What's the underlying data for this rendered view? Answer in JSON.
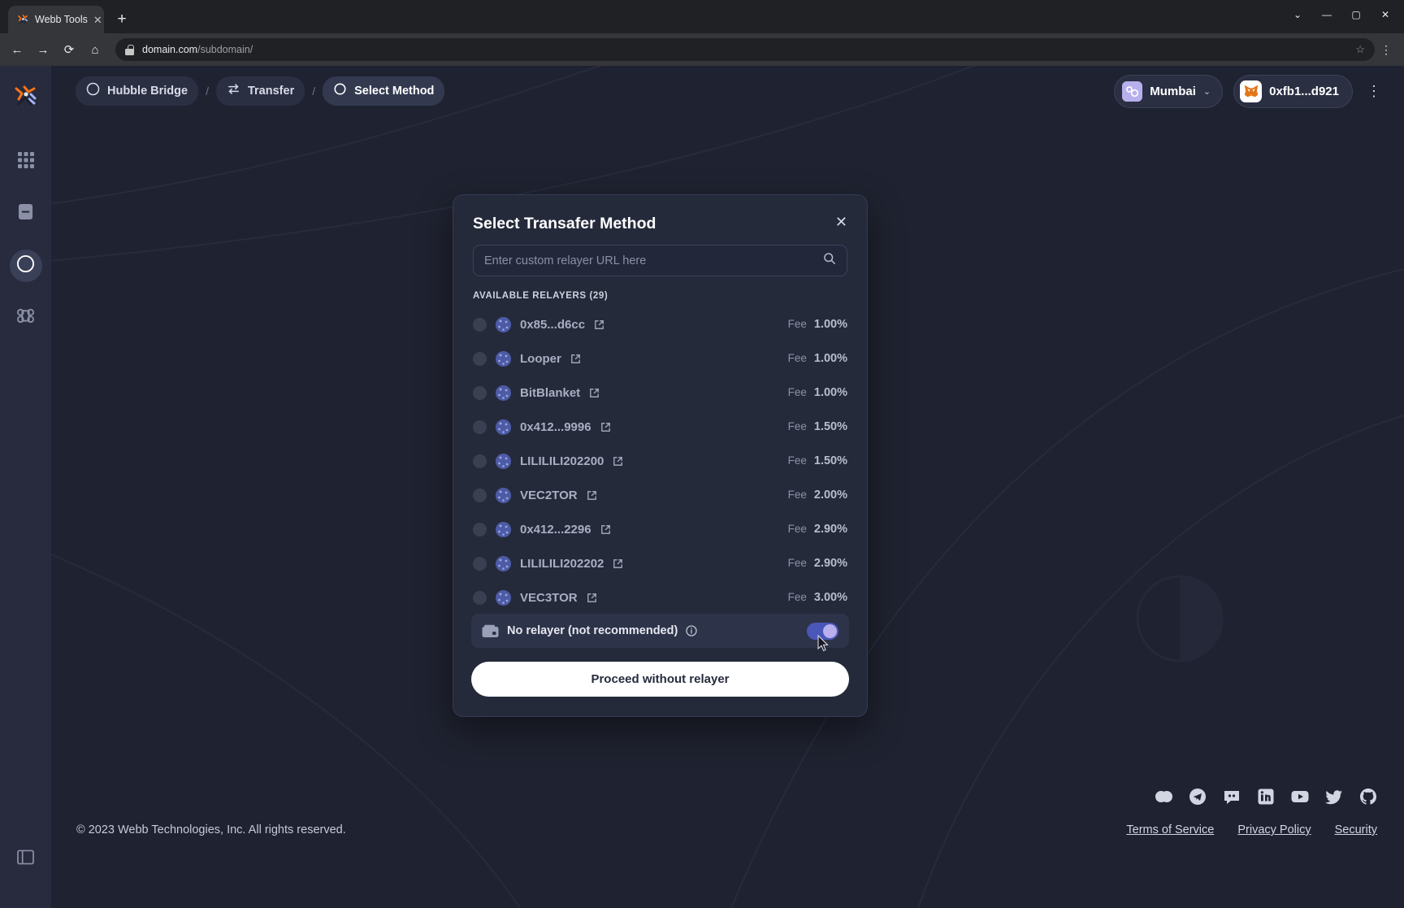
{
  "browser": {
    "tab_title": "Webb Tools",
    "tab_close": "✕",
    "newtab_label": "+",
    "window_minimize": "—",
    "window_maximize": "▢",
    "window_close": "✕",
    "window_chevron": "⌄",
    "back_icon": "←",
    "forward_icon": "→",
    "reload_icon": "⟳",
    "home_icon": "⌂",
    "url_domain": "domain.com",
    "url_path": "/subdomain/",
    "star_icon": "☆",
    "menu_icon": "⋮"
  },
  "sidebar": {
    "items": [
      {
        "name": "webb-logo",
        "label": ""
      },
      {
        "name": "apps-grid",
        "label": ""
      },
      {
        "name": "statistics",
        "label": ""
      },
      {
        "name": "bridge",
        "label": "",
        "active": true
      },
      {
        "name": "faucet",
        "label": ""
      },
      {
        "name": "docs",
        "label": ""
      }
    ]
  },
  "topbar": {
    "breadcrumbs": [
      {
        "label": "Hubble Bridge",
        "icon": "bridge-icon",
        "state": "chip"
      },
      {
        "label": "Transfer",
        "icon": "transfer-icon",
        "state": "chip"
      },
      {
        "label": "Select Method",
        "icon": "circle-icon",
        "state": "current"
      }
    ],
    "separator": "/",
    "chain": {
      "name": "Mumbai",
      "chevron": "⌄"
    },
    "account": {
      "address": "0xfb1...d921"
    },
    "overflow_menu": "⋮"
  },
  "modal": {
    "title": "Select Transafer Method",
    "close_label": "✕",
    "search_placeholder": "Enter custom relayer URL here",
    "search_value": "",
    "search_icon": "search-icon",
    "section_label": "AVAILABLE RELAYERS (29)",
    "fee_label": "Fee",
    "relayers": [
      {
        "name": "0x85...d6cc",
        "fee": "1.00%",
        "selected": false
      },
      {
        "name": "Looper",
        "fee": "1.00%",
        "selected": false
      },
      {
        "name": "BitBlanket",
        "fee": "1.00%",
        "selected": false
      },
      {
        "name": "0x412...9996",
        "fee": "1.50%",
        "selected": false
      },
      {
        "name": "LILILILI202200",
        "fee": "1.50%",
        "selected": false
      },
      {
        "name": "VEC2TOR",
        "fee": "2.00%",
        "selected": false
      },
      {
        "name": "0x412...2296",
        "fee": "2.90%",
        "selected": false
      },
      {
        "name": "LILILILI202202",
        "fee": "2.90%",
        "selected": false
      },
      {
        "name": "VEC3TOR",
        "fee": "3.00%",
        "selected": false
      }
    ],
    "no_relayer": {
      "label": "No relayer (not recommended)",
      "info_icon": "info-icon",
      "wallet_icon": "wallet-icon",
      "toggle_on": true
    },
    "proceed_label": "Proceed without relayer"
  },
  "footer": {
    "copyright": "© 2023 Webb Technologies, Inc. All rights reserved.",
    "socials": [
      "commons-icon",
      "telegram-icon",
      "discord-icon",
      "linkedin-icon",
      "youtube-icon",
      "twitter-icon",
      "github-icon"
    ],
    "links": [
      "Terms of Service",
      "Privacy Policy",
      "Security"
    ]
  },
  "colors": {
    "app_bg": "#1f2230",
    "sidebar_bg": "#272b3d",
    "modal_bg": "#252a3b",
    "accent": "#4b57b8",
    "knob": "#b7b0ec",
    "button_bg": "#ffffff"
  }
}
